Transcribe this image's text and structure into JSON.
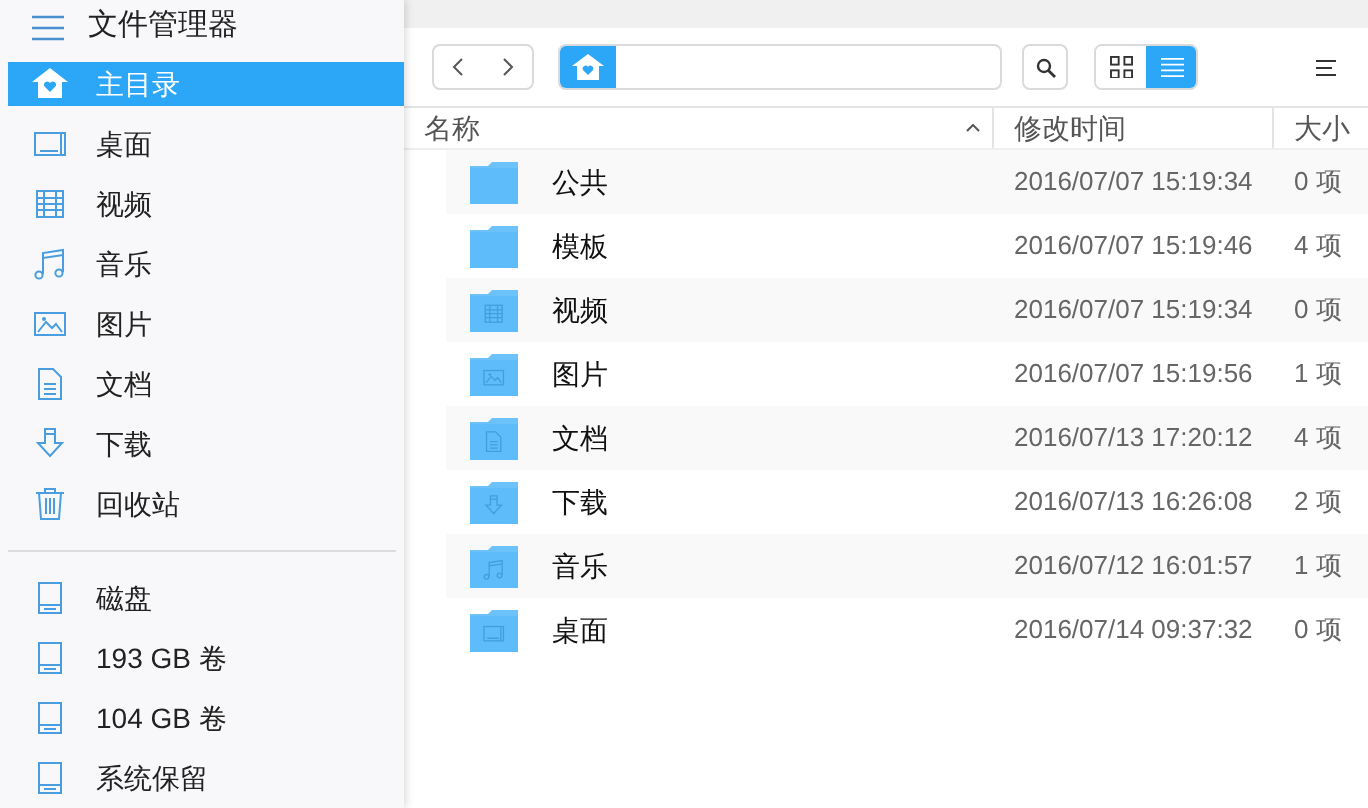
{
  "sidebar": {
    "title": "文件管理器",
    "places": [
      {
        "label": "主目录",
        "kind": "home",
        "selected": true
      },
      {
        "label": "桌面",
        "kind": "desktop",
        "selected": false
      },
      {
        "label": "视频",
        "kind": "video",
        "selected": false
      },
      {
        "label": "音乐",
        "kind": "music",
        "selected": false
      },
      {
        "label": "图片",
        "kind": "image",
        "selected": false
      },
      {
        "label": "文档",
        "kind": "document",
        "selected": false
      },
      {
        "label": "下载",
        "kind": "download",
        "selected": false
      },
      {
        "label": "回收站",
        "kind": "trash",
        "selected": false
      }
    ],
    "devices": [
      {
        "label": "磁盘",
        "kind": "disk",
        "selected": false
      },
      {
        "label": "193 GB 卷",
        "kind": "disk",
        "selected": false
      },
      {
        "label": "104 GB 卷",
        "kind": "disk",
        "selected": false
      },
      {
        "label": "系统保留",
        "kind": "disk",
        "selected": false
      }
    ]
  },
  "toolbar": {
    "views": [
      {
        "kind": "grid",
        "selected": false
      },
      {
        "kind": "list",
        "selected": true
      }
    ]
  },
  "table": {
    "columns": [
      {
        "label": "名称",
        "sorted": true
      },
      {
        "label": "修改时间",
        "sorted": false
      },
      {
        "label": "大小",
        "sorted": false
      }
    ],
    "rows": [
      {
        "name": "公共",
        "kind": "plain",
        "modified": "2016/07/07 15:19:34",
        "size": "0 项"
      },
      {
        "name": "模板",
        "kind": "plain",
        "modified": "2016/07/07 15:19:46",
        "size": "4 项"
      },
      {
        "name": "视频",
        "kind": "video",
        "modified": "2016/07/07 15:19:34",
        "size": "0 项"
      },
      {
        "name": "图片",
        "kind": "image",
        "modified": "2016/07/07 15:19:56",
        "size": "1 项"
      },
      {
        "name": "文档",
        "kind": "document",
        "modified": "2016/07/13 17:20:12",
        "size": "4 项"
      },
      {
        "name": "下载",
        "kind": "download",
        "modified": "2016/07/13 16:26:08",
        "size": "2 项"
      },
      {
        "name": "音乐",
        "kind": "music",
        "modified": "2016/07/12 16:01:57",
        "size": "1 项"
      },
      {
        "name": "桌面",
        "kind": "desktop",
        "modified": "2016/07/14 09:37:32",
        "size": "0 项"
      }
    ]
  }
}
